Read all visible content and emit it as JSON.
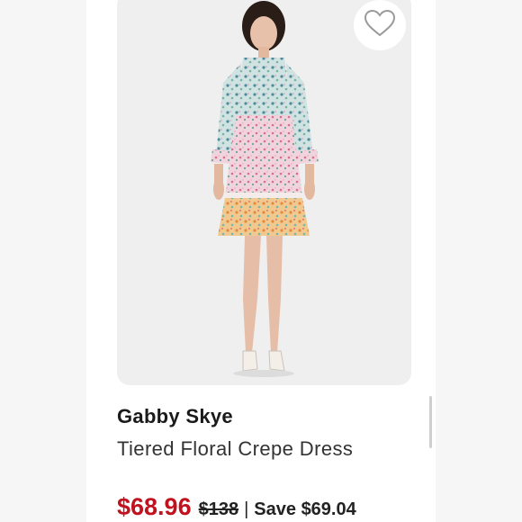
{
  "product": {
    "brand": "Gabby Skye",
    "name": "Tiered Floral Crepe Dress",
    "image_alt": "Model wearing tiered floral crepe dress"
  },
  "pricing": {
    "current": "$68.96",
    "original": "$138",
    "separator": "|",
    "savings": "Save $69.04"
  },
  "icons": {
    "favorite": "heart-outline-icon"
  },
  "colors": {
    "price_sale": "#c1121f",
    "text_primary": "#1a1a1a",
    "image_background": "#efefef"
  }
}
